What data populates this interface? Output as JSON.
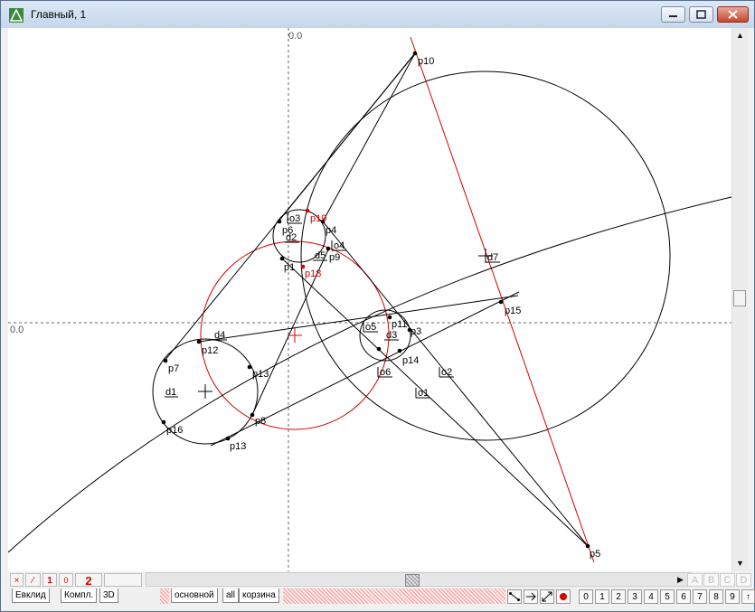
{
  "window": {
    "title": "Главный, 1"
  },
  "canvas": {
    "origin_x_label": "0.0",
    "origin_y_label": "0.0",
    "point_labels": [
      "p1",
      "p3",
      "p4",
      "p5",
      "p6",
      "p7",
      "p8",
      "p9",
      "p10",
      "p11",
      "p12",
      "p13",
      "p13",
      "p14",
      "p15",
      "p16",
      "p18",
      "p19"
    ],
    "object_labels": [
      "d1",
      "d2",
      "d3",
      "d4",
      "d5",
      "d7",
      "o1",
      "o2",
      "o3",
      "o4",
      "o5",
      "o6"
    ]
  },
  "statusbar": {
    "buttons": [
      "×",
      "⁄",
      "1",
      "0",
      "2"
    ],
    "letters": [
      "A",
      "B",
      "C",
      "D"
    ]
  },
  "tabs": {
    "left": [
      "Евклид",
      "Компл.",
      "3D"
    ],
    "right": [
      "основной",
      "all",
      "корзина"
    ]
  },
  "toolbar": {
    "digits": [
      "0",
      "1",
      "2",
      "3",
      "4",
      "5",
      "6",
      "7",
      "8",
      "9",
      "↑"
    ]
  },
  "colors": {
    "construction": "#000000",
    "highlight": "#d40000",
    "titlebar": "#c5d6ec"
  }
}
